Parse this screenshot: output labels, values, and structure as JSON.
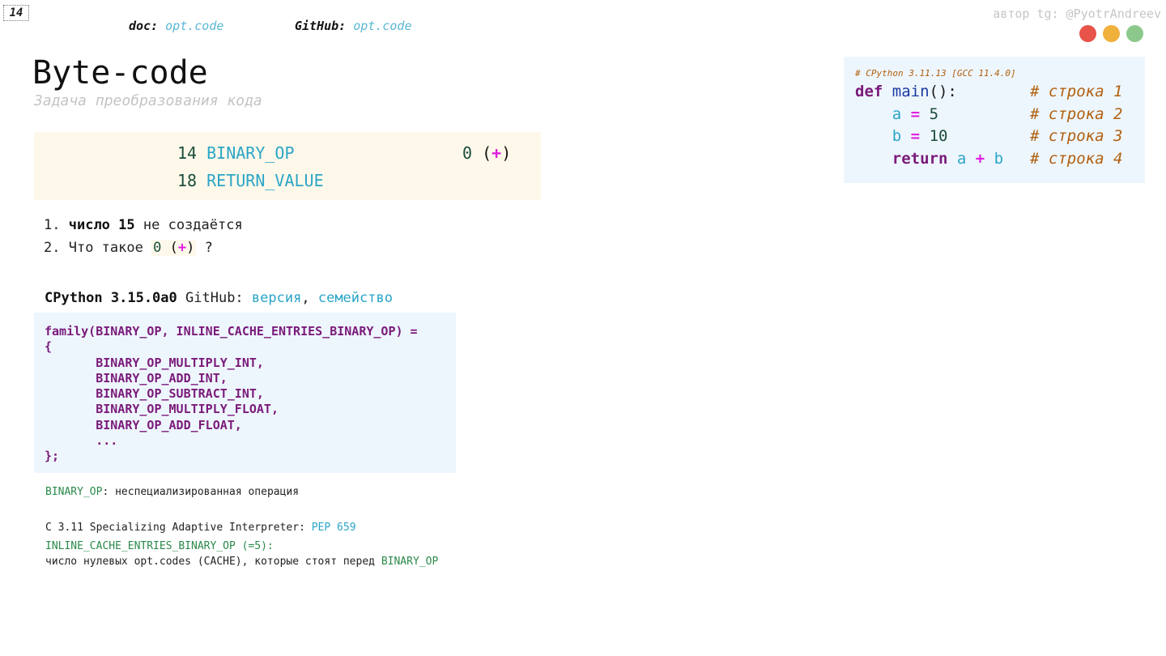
{
  "slide_number": "14",
  "header": {
    "doc_label": "doc:",
    "doc_link": "opt.code",
    "github_label": "GitHub:",
    "github_link": "opt.code",
    "author": "автор tg: @PyotrAndreev"
  },
  "window_controls": {
    "colors": [
      "#e8534a",
      "#f0b03c",
      "#8cc88c"
    ]
  },
  "title": "Byte-code",
  "subtitle": "Задача преобразования кода",
  "bytecode": {
    "rows": [
      {
        "offset": "14",
        "opname": "BINARY_OP",
        "arg": "0",
        "arg_open": "(",
        "arg_symbol": "+",
        "arg_close": ")"
      },
      {
        "offset": "18",
        "opname": "RETURN_VALUE"
      }
    ]
  },
  "points": {
    "p1_num": "1.",
    "p1_bold": "число 15",
    "p1_rest": "не создаётся",
    "p2_num": "2.",
    "p2_text": "Что такое",
    "p2_zero": "0",
    "p2_open": "(",
    "p2_plus": "+",
    "p2_close": ")",
    "p2_q": "?"
  },
  "cpython": {
    "version": "CPython 3.15.0a0",
    "github": "GitHub:",
    "link_version": "версия",
    "comma": ",",
    "link_family": "семейство"
  },
  "family_code": "family(BINARY_OP, INLINE_CACHE_ENTRIES_BINARY_OP) =\n{\n       BINARY_OP_MULTIPLY_INT,\n       BINARY_OP_ADD_INT,\n       BINARY_OP_SUBTRACT_INT,\n       BINARY_OP_MULTIPLY_FLOAT,\n       BINARY_OP_ADD_FLOAT,\n       ...\n};",
  "notes": {
    "binary_op": "BINARY_OP",
    "binary_op_desc": ": неспециализированная операция",
    "spec_text": "C 3.11 Specializing Adaptive Interpreter:",
    "pep": "PEP 659",
    "inline_cache": "INLINE_CACHE_ENTRIES_BINARY_OP (=5):",
    "zero_codes": "число нулевых opt.codes (CACHE), которые стоят перед",
    "zero_codes_op": "BINARY_OP"
  },
  "source": {
    "comment": "# CPython 3.11.13 [GCC 11.4.0]",
    "lines": [
      {
        "comment": "# строка 1"
      },
      {
        "comment": "# строка 2"
      },
      {
        "comment": "# строка 3"
      },
      {
        "comment": "# строка 4"
      }
    ],
    "kw_def": "def",
    "fn_name": "main",
    "fn_sig": "():",
    "var_a": "a",
    "var_b": "b",
    "eq": "=",
    "val_a": "5",
    "val_b": "10",
    "kw_return": "return",
    "plus": "+"
  }
}
